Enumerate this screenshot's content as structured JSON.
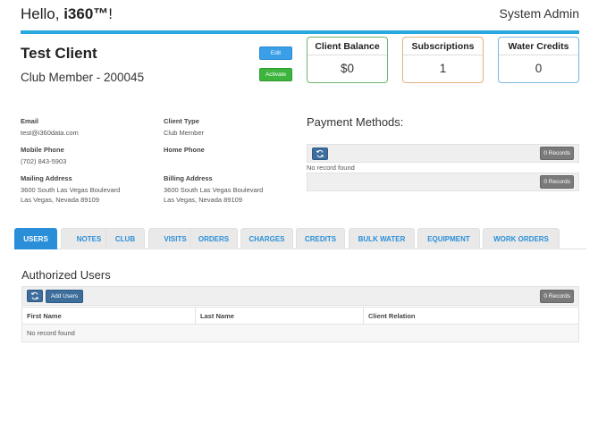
{
  "header": {
    "greeting_prefix": "Hello, ",
    "username": "i360™",
    "greeting_suffix": "!",
    "role": "System Admin",
    "accent_color": "#29a8e0"
  },
  "client": {
    "name": "Test Client",
    "membership": "Club Member - 200045",
    "edit_label": "Edit",
    "activate_label": "Activate"
  },
  "cards": {
    "balance": {
      "title": "Client Balance",
      "value": "$0"
    },
    "subscriptions": {
      "title": "Subscriptions",
      "value": "1"
    },
    "water": {
      "title": "Water Credits",
      "value": "0"
    }
  },
  "fields": {
    "email_label": "Email",
    "email": "test@i360data.com",
    "client_type_label": "Client Type",
    "client_type": "Club Member",
    "mobile_label": "Mobile Phone",
    "mobile": "(702) 843-5903",
    "home_label": "Home Phone",
    "home": "",
    "mailing_label": "Mailing Address",
    "mailing_line1": "3600 South Las Vegas Boulevard",
    "mailing_line2": "Las Vegas, Nevada 89109",
    "billing_label": "Billing Address",
    "billing_line1": "3600 South Las Vegas Boulevard",
    "billing_line2": "Las Vegas, Nevada 89109"
  },
  "payment": {
    "title": "Payment Methods:",
    "records1": "0 Records",
    "no_record": "No record found",
    "records2": "0 Records"
  },
  "tabs": [
    "USERS",
    "NOTES",
    "CLUB",
    "VISITS",
    "ORDERS",
    "CHARGES",
    "CREDITS",
    "BULK WATER",
    "EQUIPMENT",
    "WORK ORDERS"
  ],
  "authorized_users": {
    "title": "Authorized Users",
    "add_label": "Add Users",
    "records": "0 Records",
    "columns": [
      "First Name",
      "Last Name",
      "Client Relation"
    ],
    "no_record": "No record found"
  },
  "icons": {
    "refresh": "refresh-icon"
  }
}
